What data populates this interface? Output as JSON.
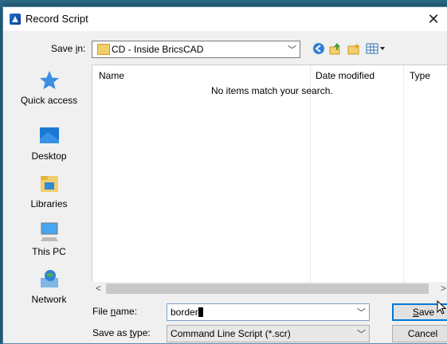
{
  "window": {
    "title": "Record Script",
    "close_glyph": "✕"
  },
  "save_in": {
    "label_pre": "Save ",
    "label_ul": "i",
    "label_post": "n:",
    "value": "CD - Inside BricsCAD"
  },
  "toolbar": {
    "back_icon": "back-icon",
    "up_icon": "up-folder-icon",
    "new_folder_icon": "new-folder-icon",
    "view_icon": "view-menu-icon"
  },
  "sidebar": {
    "items": [
      {
        "label": "Quick access",
        "icon": "star-icon"
      },
      {
        "label": "Desktop",
        "icon": "desktop-icon"
      },
      {
        "label": "Libraries",
        "icon": "libraries-icon"
      },
      {
        "label": "This PC",
        "icon": "computer-icon"
      },
      {
        "label": "Network",
        "icon": "network-icon"
      }
    ]
  },
  "list": {
    "columns": [
      "Name",
      "Date modified",
      "Type"
    ],
    "empty_message": "No items match your search."
  },
  "file_name": {
    "label_pre": "File ",
    "label_ul": "n",
    "label_post": "ame:",
    "value": "border"
  },
  "save_as_type": {
    "label_pre": "Save as ",
    "label_ul": "t",
    "label_post": "ype:",
    "value": "Command Line Script (*.scr)"
  },
  "buttons": {
    "save_ul": "S",
    "save_post": "ave",
    "cancel": "Cancel"
  },
  "colors": {
    "accent": "#0078d7",
    "title_icon": "#1f6fd1"
  }
}
